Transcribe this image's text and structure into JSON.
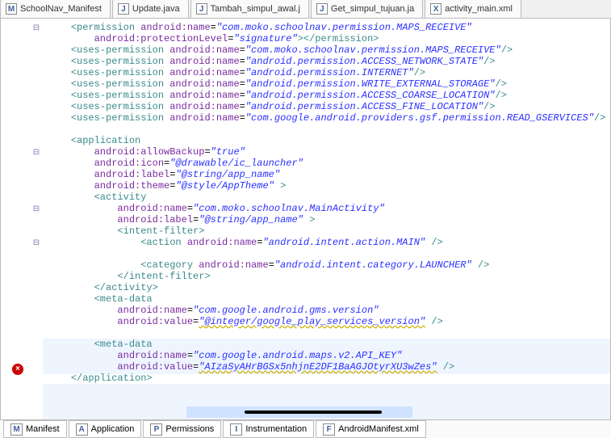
{
  "tabs": [
    {
      "label": "SchoolNav_Manifest",
      "icon": "M"
    },
    {
      "label": "Update.java",
      "icon": "J"
    },
    {
      "label": "Tambah_simpul_awal.j",
      "icon": "J"
    },
    {
      "label": "Get_simpul_tujuan.ja",
      "icon": "J"
    },
    {
      "label": "activity_main.xml",
      "icon": "X"
    }
  ],
  "bottom_tabs": [
    {
      "label": "Manifest",
      "icon": "M"
    },
    {
      "label": "Application",
      "icon": "A"
    },
    {
      "label": "Permissions",
      "icon": "P"
    },
    {
      "label": "Instrumentation",
      "icon": "I"
    },
    {
      "label": "AndroidManifest.xml",
      "icon": "F"
    }
  ],
  "code": {
    "perm_open": "<permission",
    "perm_close": "</permission>",
    "uses_perm": "<uses-permission",
    "application": "<application",
    "activity": "<activity",
    "activity_close": "</activity>",
    "intent_open": "<intent-filter>",
    "intent_close": "</intent-filter>",
    "action": "<action",
    "category": "<category",
    "meta": "<meta-data",
    "app_close": "</application>",
    "attr": {
      "name": "android:name",
      "protLevel": "android:protectionLevel",
      "allowBackup": "android:allowBackup",
      "icon": "android:icon",
      "label": "android:label",
      "theme": "android:theme",
      "value": "android:value"
    },
    "vals": {
      "maps_receive": "\"com.moko.schoolnav.permission.MAPS_RECEIVE\"",
      "signature": "\"signature\"",
      "access_network": "\"android.permission.ACCESS_NETWORK_STATE\"",
      "internet": "\"android.permission.INTERNET\"",
      "write_ext": "\"android.permission.WRITE_EXTERNAL_STORAGE\"",
      "coarse": "\"android.permission.ACCESS_COARSE_LOCATION\"",
      "fine": "\"android.permission.ACCESS_FINE_LOCATION\"",
      "gservices": "\"com.google.android.providers.gsf.permission.READ_GSERVICES\"",
      "true": "\"true\"",
      "ic_launcher": "\"@drawable/ic_launcher\"",
      "app_name": "\"@string/app_name\"",
      "apptheme": "\"@style/AppTheme\"",
      "mainactivity": "\"com.moko.schoolnav.MainActivity\"",
      "action_main": "\"android.intent.action.MAIN\"",
      "cat_launcher": "\"android.intent.category.LAUNCHER\"",
      "gms_version": "\"com.google.android.gms.version\"",
      "gms_value": "\"@integer/google_play_services_version\"",
      "maps_key": "\"com.google.android.maps.v2.API_KEY\"",
      "key_value": "\"AIzaSyAHrBGSx5nhjnE2DF1BaAGJOtyrXU3wZes\""
    },
    "close_self": "/>",
    "close_tag": ">"
  }
}
